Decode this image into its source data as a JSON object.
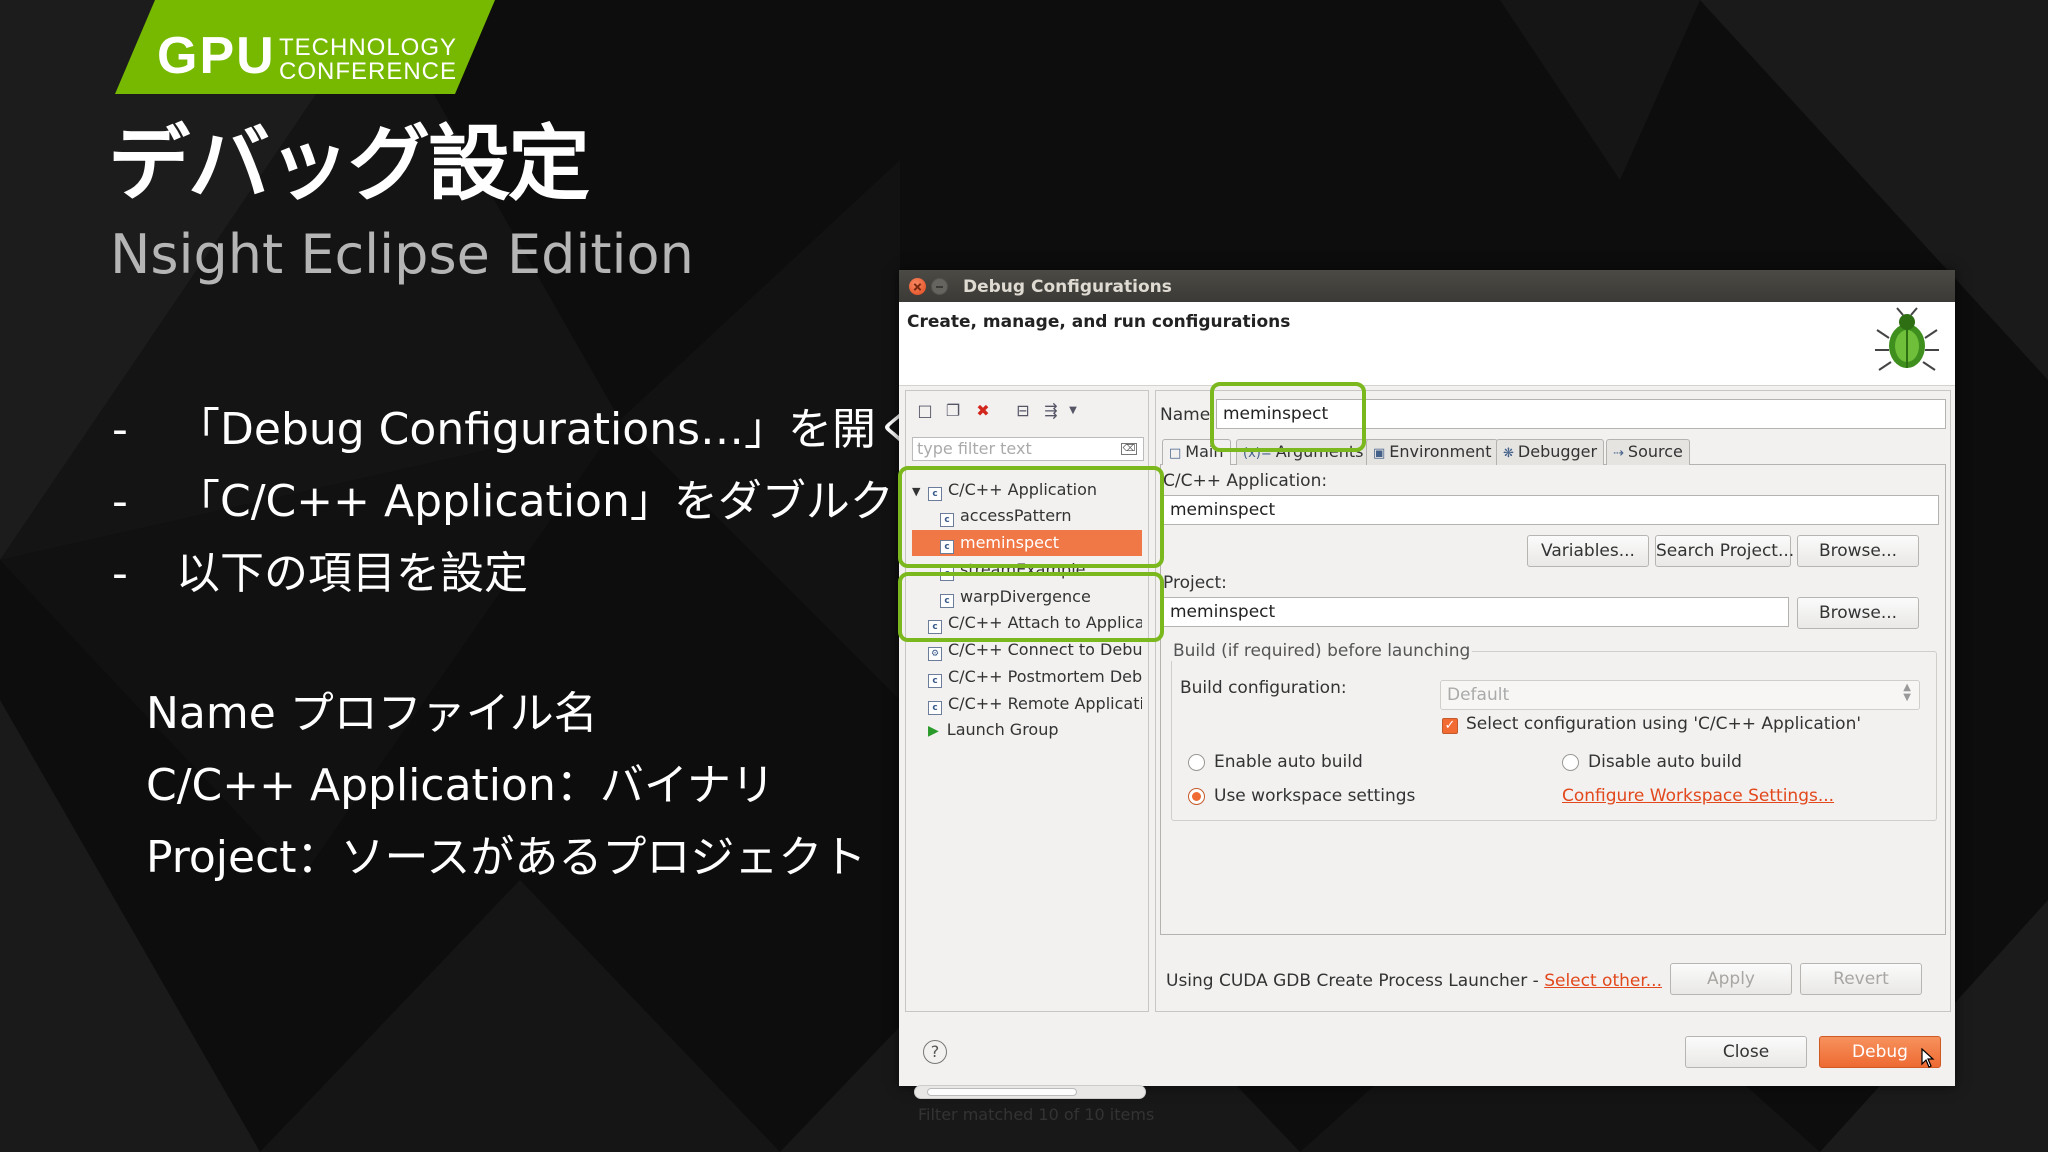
{
  "colors": {
    "nvidia_green": "#76b900",
    "highlight": "#7bb81e",
    "accent_orange": "#f07746",
    "background": "#0d0d0d"
  },
  "logo": {
    "gpu": "GPU",
    "line1": "TECHNOLOGY",
    "line2": "CONFERENCE"
  },
  "slide": {
    "title": "デバッグ設定",
    "subtitle": "Nsight Eclipse Edition",
    "bullets": [
      {
        "dash": "-",
        "text": "「Debug Configurations…」を開く"
      },
      {
        "dash": "-",
        "text": "「C/C++ Application」をダブルクリック"
      },
      {
        "dash": "-",
        "text": "以下の項目を設定"
      }
    ],
    "settings": [
      "Name プロファイル名",
      " C/C++ Application：バイナリ",
      "Project：ソースがあるプロジェクト"
    ]
  },
  "dialog": {
    "title": "Debug Configurations",
    "header": "Create, manage, and run configurations",
    "icon": "bug-icon",
    "toolbar_icons": [
      "new-config-icon",
      "duplicate-icon",
      "delete-icon",
      "collapse-all-icon",
      "filter-icon",
      "dropdown-icon"
    ],
    "filter_placeholder": "type filter text",
    "tree": [
      {
        "label": "C/C++ Application",
        "level": 0,
        "expanded": true
      },
      {
        "label": "accessPattern",
        "level": 1
      },
      {
        "label": "meminspect",
        "level": 1,
        "selected": true
      },
      {
        "label": "streamExample",
        "level": 1
      },
      {
        "label": "warpDivergence",
        "level": 1
      },
      {
        "label": "C/C++ Attach to Applicat",
        "level": 0
      },
      {
        "label": "C/C++ Connect to Debug",
        "level": 0
      },
      {
        "label": "C/C++ Postmortem Debu",
        "level": 0
      },
      {
        "label": "C/C++ Remote Applicatic",
        "level": 0
      },
      {
        "label": "Launch Group",
        "level": 0
      }
    ],
    "filter_status": "Filter matched 10 of 10 items",
    "name_label": "Name:",
    "name_value": "meminspect",
    "tabs": [
      "Main",
      "Arguments",
      "Environment",
      "Debugger",
      "Source"
    ],
    "app_label": "C/C++ Application:",
    "app_value": "meminspect",
    "variables_button": "Variables...",
    "search_project_button": "Search Project...",
    "browse_button": "Browse...",
    "project_label": "Project:",
    "project_value": "meminspect",
    "build_group": "Build (if required) before launching",
    "build_config_label": "Build configuration:",
    "build_config_value": "Default",
    "select_config_label": "Select configuration using 'C/C++ Application'",
    "enable_auto_build": "Enable auto build",
    "disable_auto_build": "Disable auto build",
    "use_workspace": "Use workspace settings",
    "configure_workspace": "Configure Workspace Settings...",
    "launcher_text": "Using CUDA GDB Create Process Launcher - ",
    "select_other": "Select other...",
    "apply": "Apply",
    "revert": "Revert",
    "close": "Close",
    "debug": "Debug",
    "help": "?"
  }
}
